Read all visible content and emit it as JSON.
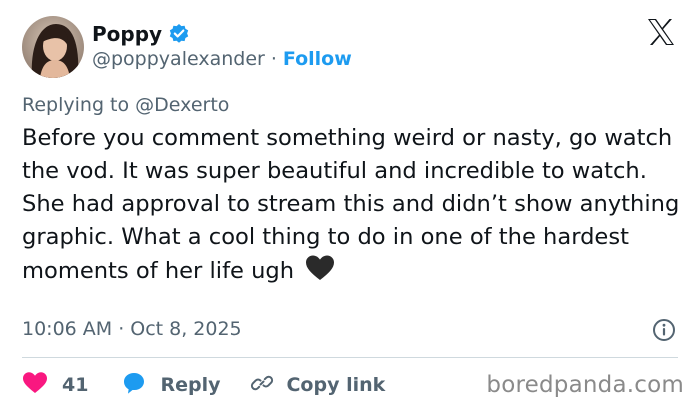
{
  "author": {
    "name": "Poppy",
    "handle": "@poppyalexander",
    "separator": "·",
    "follow_label": "Follow"
  },
  "reply": {
    "prefix": "Replying to",
    "mention": "@Dexerto"
  },
  "tweet": {
    "text": "Before you comment something weird or nasty, go watch the vod. It was super beautiful and incredible to watch. She had approval to stream this and didn’t show anything graphic. What a cool thing to do in one of the hardest moments of her life ugh",
    "emoji": "black-heart-icon"
  },
  "meta": {
    "time": "10:06 AM",
    "separator": "·",
    "date": "Oct 8, 2025"
  },
  "actions": {
    "like_count": "41",
    "reply_label": "Reply",
    "copy_label": "Copy link"
  },
  "watermark": "boredpanda.com",
  "colors": {
    "brand_blue": "#1d9bf0",
    "like_pink": "#f91880",
    "muted_text": "#536471"
  }
}
